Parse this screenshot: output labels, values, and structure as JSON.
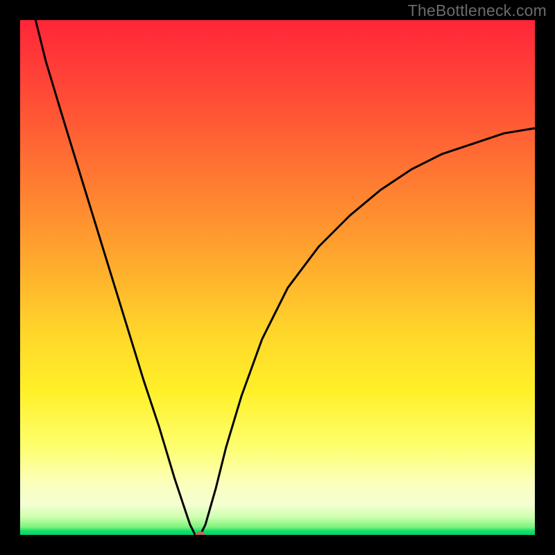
{
  "watermark": "TheBottleneck.com",
  "chart_data": {
    "type": "line",
    "title": "",
    "xlabel": "",
    "ylabel": "",
    "xlim": [
      0,
      100
    ],
    "ylim": [
      0,
      100
    ],
    "series": [
      {
        "name": "bottleneck-curve",
        "x": [
          3,
          5,
          8,
          12,
          16,
          20,
          24,
          27,
          30,
          32,
          33,
          34,
          35,
          36,
          38,
          40,
          43,
          47,
          52,
          58,
          64,
          70,
          76,
          82,
          88,
          94,
          100
        ],
        "values": [
          100,
          92,
          82,
          69,
          56,
          43,
          30,
          21,
          11,
          5,
          2,
          0,
          0,
          2,
          9,
          17,
          27,
          38,
          48,
          56,
          62,
          67,
          71,
          74,
          76,
          78,
          79
        ]
      }
    ],
    "marker": {
      "x": 35,
      "y": 0,
      "color": "#c46a5d",
      "rx": 7,
      "ry": 5
    },
    "background_gradient": {
      "top": "#ff2637",
      "mid": "#ffd42a",
      "bottom": "#00d66a"
    }
  }
}
